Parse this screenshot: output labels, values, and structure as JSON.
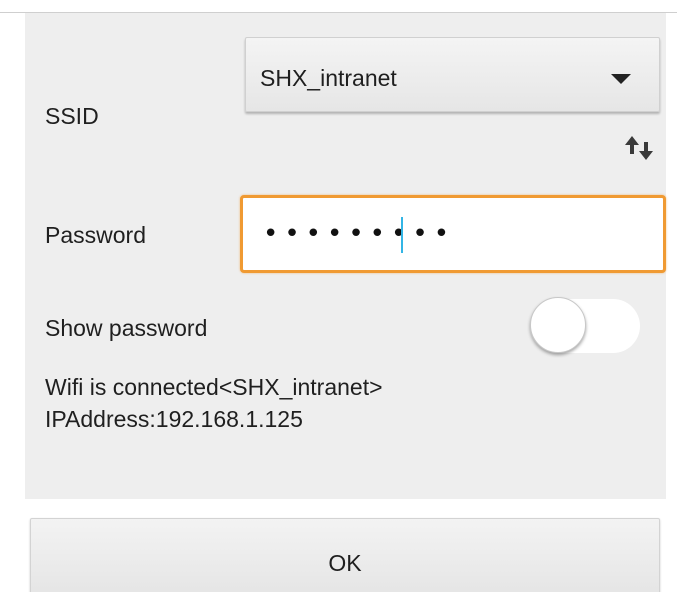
{
  "form": {
    "ssid_label": "SSID",
    "ssid_value": "SHX_intranet",
    "password_label": "Password",
    "password_value": "•••••••••",
    "show_password_label": "Show password",
    "show_password_on": false
  },
  "status": {
    "line1": "Wifi is connected<SHX_intranet>",
    "line2": "IPAddress:192.168.1.125"
  },
  "actions": {
    "ok_label": "OK"
  },
  "icons": {
    "dropdown": "caret-down-icon",
    "refresh": "refresh-arrows-icon"
  },
  "colors": {
    "focus_border": "#f09a32",
    "cursor": "#33b5e5",
    "panel_bg": "#eeeeee"
  }
}
